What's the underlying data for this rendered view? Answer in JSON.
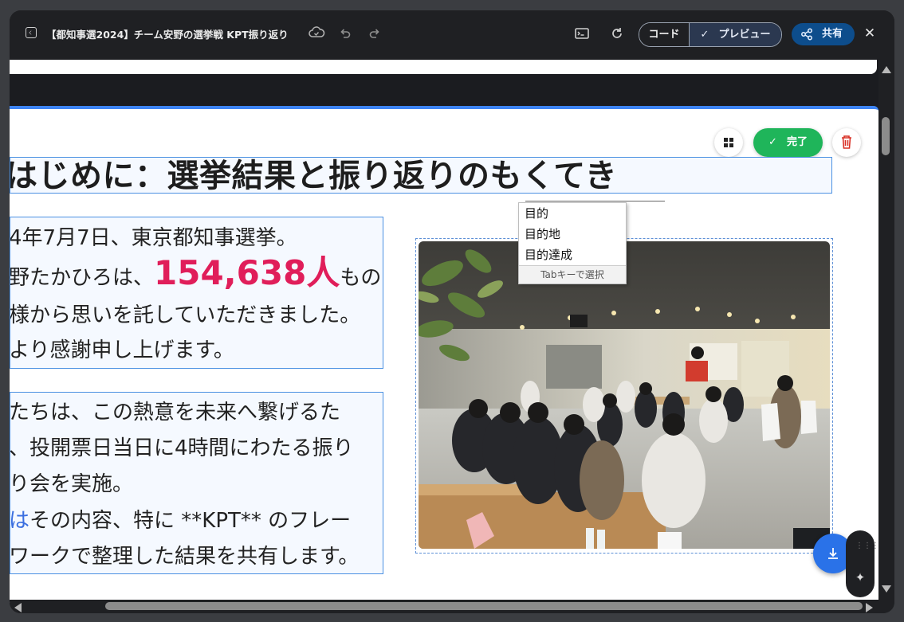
{
  "header": {
    "title": "【都知事選2024】チーム安野の選挙戦 KPT振り返り",
    "code_tab": "コード",
    "preview_tab": "プレビュー",
    "share_label": "共有",
    "icons": [
      "doc-icon",
      "cloud-sync-icon",
      "undo-icon",
      "redo-icon",
      "terminal-icon",
      "refresh-icon",
      "check-icon",
      "share-icon",
      "close-icon"
    ]
  },
  "toolbar": {
    "done_label": "完了",
    "icons": [
      "grid-icon",
      "check-icon",
      "trash-icon"
    ]
  },
  "slide": {
    "heading": "はじめに：選挙結果と振り返りのもくてき",
    "p1": {
      "l1": "4年7月7日、東京都知事選挙。",
      "l2a": "野たかひろは、",
      "l2big": "154,638人",
      "l2b": "もの",
      "l3": "様から思いを託していただきました。",
      "l4": "より感謝申し上げます。"
    },
    "p2": {
      "l1": "たちは、この熱意を未来へ繋げるた",
      "l2": "、投開票日当日に4時間にわたる振り",
      "l3": "り会を実施。",
      "l4a": "は",
      "l4b": "その内容、特に **KPT** のフレー",
      "l5": "ワークで整理した結果を共有します。"
    }
  },
  "autocomplete": {
    "items": [
      "目的",
      "目的地",
      "目的達成"
    ],
    "hint": "Tabキーで選択"
  },
  "colors": {
    "accent": "#3e84f4",
    "done": "#1fb55a",
    "highlight_number": "#e01e5a",
    "share": "#0d4d8c"
  }
}
